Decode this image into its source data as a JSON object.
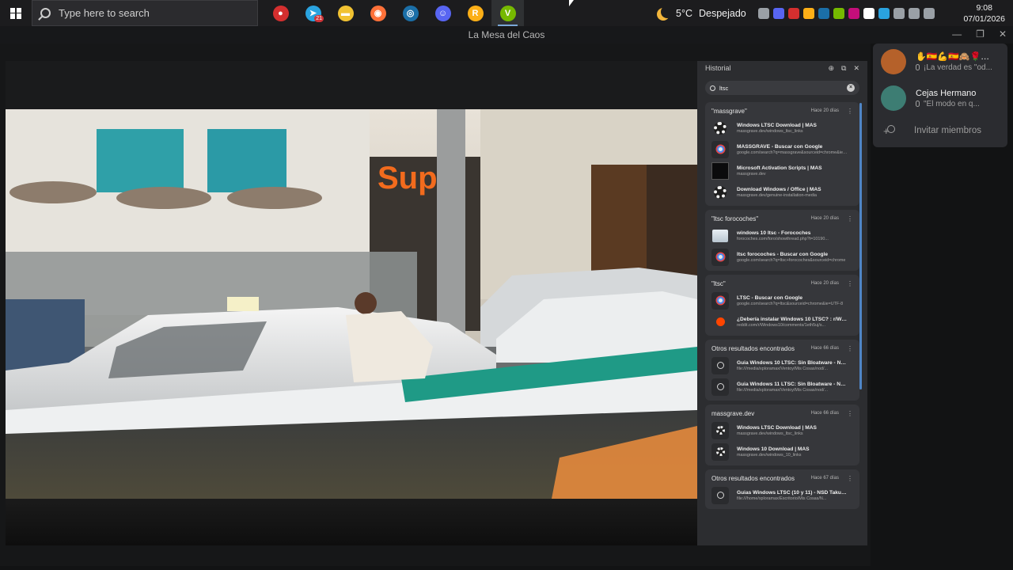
{
  "taskbar": {
    "search_placeholder": "Type here to search",
    "apps": [
      {
        "name": "screen-recorder-icon",
        "color": "#d42f2f",
        "glyph": "●"
      },
      {
        "name": "telegram-icon",
        "color": "#2aa3e0",
        "glyph": "➤",
        "badge": "21"
      },
      {
        "name": "file-explorer-icon",
        "color": "#f1c232",
        "glyph": "▬"
      },
      {
        "name": "firefox-icon",
        "color": "#ff7139",
        "glyph": "◉"
      },
      {
        "name": "steam-icon",
        "color": "#1b6fa8",
        "glyph": "◎"
      },
      {
        "name": "discord-icon",
        "color": "#5865f2",
        "glyph": "☺"
      },
      {
        "name": "rockstar-launcher-icon",
        "color": "#fcaf17",
        "glyph": "R"
      },
      {
        "name": "nvidia-app-icon",
        "color": "#76b900",
        "glyph": "V"
      }
    ],
    "weather": {
      "temp": "5°C",
      "condition": "Despejado"
    },
    "tray_colors": [
      "#9aa0a6",
      "#5865f2",
      "#d42f2f",
      "#fcaf17",
      "#1b6fa8",
      "#76b900",
      "#c40e7a",
      "#ffffff",
      "#2aa3e0",
      "#9aa0a6",
      "#9aa0a6",
      "#9aa0a6"
    ],
    "clock": {
      "time": "9:08",
      "date": "07/01/2026"
    }
  },
  "window": {
    "title": "La Mesa del Caos",
    "buttons": {
      "minimize": "—",
      "restore": "❐",
      "close": "✕"
    }
  },
  "history": {
    "title": "Historial",
    "header_buttons": {
      "pin": "⊕",
      "popout": "⧉",
      "close": "✕"
    },
    "search_value": "ltsc",
    "groups": [
      {
        "title": "\"massgrave\"",
        "ago": "Hace 20 días",
        "entries": [
          {
            "icon": "masgear",
            "title": "Windows LTSC Download | MAS",
            "url": "massgrave.dev/windows_ltsc_links"
          },
          {
            "icon": "chrome",
            "title": "MASSGRAVE - Buscar con Google",
            "url": "google.com/search?q=massgrave&sourceid=chrome&ie=UTF-8"
          },
          {
            "icon": "dark",
            "title": "Microsoft Activation Scripts | MAS",
            "url": "massgrave.dev"
          },
          {
            "icon": "masgear",
            "title": "Download Windows / Office | MAS",
            "url": "massgrave.dev/genuine-installation-media"
          }
        ]
      },
      {
        "title": "\"ltsc forocoches\"",
        "ago": "Hace 20 días",
        "entries": [
          {
            "icon": "thumb",
            "title": "windows 10 ltsc - Forocoches",
            "url": "forocoches.com/foro/showthread.php?t=10190..."
          },
          {
            "icon": "chrome",
            "title": "ltsc forocoches - Buscar con Google",
            "url": "google.com/search?q=ltsc+forocoches&sourceid=chrome"
          }
        ]
      },
      {
        "title": "\"ltsc\"",
        "ago": "Hace 20 días",
        "entries": [
          {
            "icon": "chrome",
            "title": "LTSC - Buscar con Google",
            "url": "google.com/search?q=ltsc&sourceid=chrome&ie=UTF-8"
          },
          {
            "icon": "reddit",
            "title": "¿Debería instalar Windows 10 LTSC? : r/Windows10",
            "url": "reddit.com/r/Windows10/comments/1eth5uj/s..."
          }
        ]
      },
      {
        "title": "Otros resultados encontrados",
        "ago": "Hace 66 días",
        "entries": [
          {
            "icon": "globe",
            "title": "Guia Windows 10 LTSC: Sin Bloatware - NSD TakuOS",
            "url": "file:///media/xploramax/Ventoy/Mis Cosas/nod/..."
          },
          {
            "icon": "globe",
            "title": "Guia Windows 11 LTSC: Sin Bloatware - NSD TakuOS",
            "url": "file:///media/xploramax/Ventoy/Mis Cosas/nod/..."
          }
        ]
      },
      {
        "title": "massgrave.dev",
        "ago": "Hace 66 días",
        "entries": [
          {
            "icon": "gear",
            "title": "Windows LTSC Download | MAS",
            "url": "massgrave.dev/windows_ltsc_links"
          },
          {
            "icon": "gear",
            "title": "Windows 10 Download | MAS",
            "url": "massgrave.dev/windows_10_links"
          }
        ]
      },
      {
        "title": "Otros resultados encontrados",
        "ago": "Hace 67 días",
        "entries": [
          {
            "icon": "globe",
            "title": "Guias Windows LTSC (10 y 11) - NSD TakuOS",
            "url": "file:///home/xploramax/Escritorio/Mis Cosas/N..."
          }
        ]
      }
    ]
  },
  "discord": {
    "members": [
      {
        "name": "✋🇪🇸💪🇪🇸🙈🌹…",
        "status": "¡La verdad es \"od...",
        "avatar_color": "#b5612a"
      },
      {
        "name": "Cejas Hermano",
        "status": "\"El modo en q...",
        "avatar_color": "#3d7d73"
      }
    ],
    "invite_label": "Invitar miembros"
  }
}
